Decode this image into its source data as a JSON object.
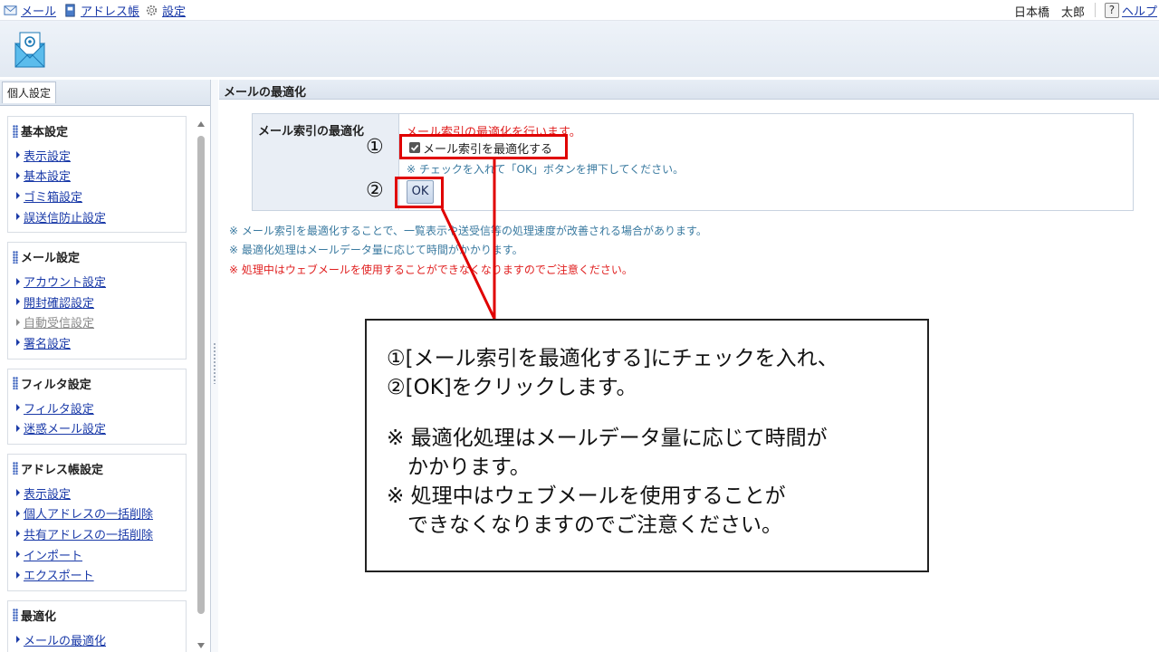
{
  "topbar": {
    "mail": "メール",
    "addressbook": "アドレス帳",
    "settings": "設定",
    "user": "日本橋　太郎",
    "help": "ヘルプ"
  },
  "left": {
    "tab": "個人設定",
    "groups": [
      {
        "title": "基本設定",
        "items": [
          "表示設定",
          "基本設定",
          "ゴミ箱設定",
          "誤送信防止設定"
        ]
      },
      {
        "title": "メール設定",
        "items": [
          "アカウント設定",
          "開封確認設定",
          "自動受信設定",
          "署名設定"
        ]
      },
      {
        "title": "フィルタ設定",
        "items": [
          "フィルタ設定",
          "迷惑メール設定"
        ]
      },
      {
        "title": "アドレス帳設定",
        "items": [
          "表示設定",
          "個人アドレスの一括削除",
          "共有アドレスの一括削除",
          "インポート",
          "エクスポート"
        ]
      },
      {
        "title": "最適化",
        "items": [
          "メールの最適化"
        ]
      }
    ]
  },
  "main": {
    "title": "メールの最適化",
    "form_label": "メール索引の最適化",
    "description": "メール索引の最適化を行います。",
    "checkbox_label": "メール索引を最適化する",
    "checkbox_checked": true,
    "check_note": "※ チェックを入れて「OK」ボタンを押下してください。",
    "ok_button": "OK",
    "notes": [
      "※ メール索引を最適化することで、一覧表示や送受信等の処理速度が改善される場合があります。",
      "※ 最適化処理はメールデータ量に応じて時間がかかります。",
      "※ 処理中はウェブメールを使用することができなくなりますのでご注意ください。"
    ]
  },
  "annotation": {
    "marker1": "①",
    "marker2": "②",
    "callout_lines": [
      "①[メール索引を最適化する]にチェックを入れ、",
      "②[OK]をクリックします。",
      "※ 最適化処理はメールデータ量に応じて時間が",
      "　かかります。",
      "※ 処理中はウェブメールを使用することが",
      "　できなくなりますのでご注意ください。"
    ]
  },
  "colors": {
    "link": "#1a3aa8",
    "highlight": "#e00000",
    "warning_text": "#e02020",
    "note_text": "#3a7aa0"
  }
}
